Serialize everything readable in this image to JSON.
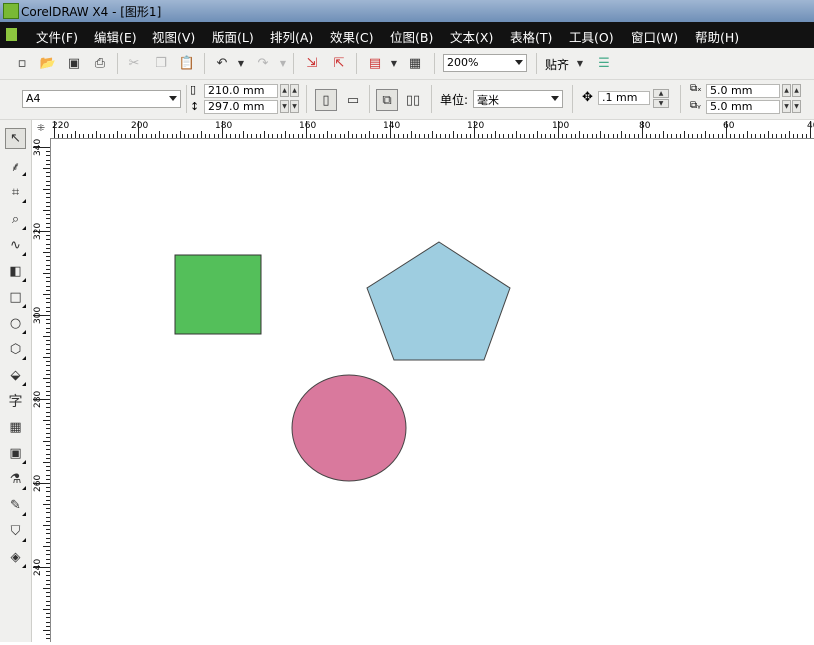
{
  "window": {
    "title": "CorelDRAW X4 - [图形1]"
  },
  "menu": [
    "文件(F)",
    "编辑(E)",
    "视图(V)",
    "版面(L)",
    "排列(A)",
    "效果(C)",
    "位图(B)",
    "文本(X)",
    "表格(T)",
    "工具(O)",
    "窗口(W)",
    "帮助(H)"
  ],
  "toolbar": {
    "zoom": "200%",
    "snap_label": "贴齐"
  },
  "propertybar": {
    "paper_size": "A4",
    "width": "210.0 mm",
    "height": "297.0 mm",
    "units_label": "单位:",
    "units_value": "毫米",
    "nudge": ".1 mm",
    "duplicate_x": "5.0 mm",
    "duplicate_y": "5.0 mm"
  },
  "rulers": {
    "horizontal": [
      "220",
      "200",
      "180",
      "160",
      "140",
      "120",
      "100",
      "80",
      "60",
      "40"
    ],
    "vertical": [
      "340",
      "320",
      "300",
      "280",
      "260",
      "240"
    ]
  },
  "shapes": [
    {
      "kind": "rectangle",
      "fill": "#54bf5a"
    },
    {
      "kind": "pentagon",
      "fill": "#9ecde0"
    },
    {
      "kind": "ellipse",
      "fill": "#d9799d"
    }
  ]
}
